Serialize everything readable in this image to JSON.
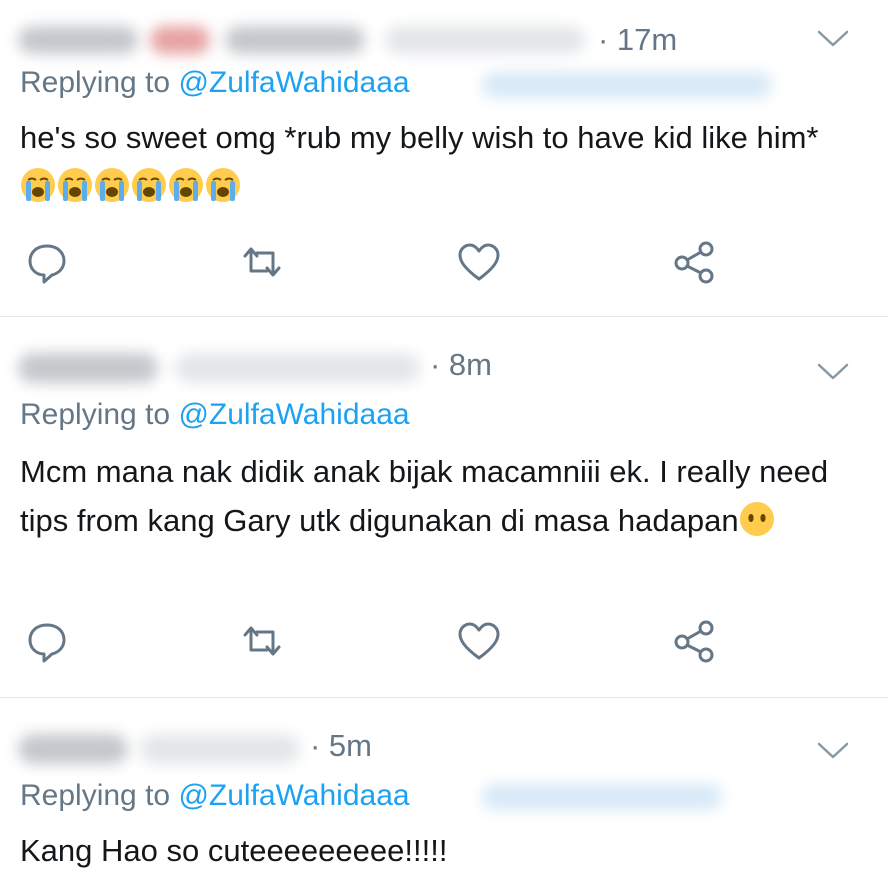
{
  "tweets": [
    {
      "time": "· 17m",
      "replying_prefix": "Replying to ",
      "handle": "@ZulfaWahidaaa",
      "text": "he's so sweet omg *rub my belly wish to have kid like him* ",
      "emojis": [
        "loudly-crying-face",
        "loudly-crying-face",
        "loudly-crying-face",
        "loudly-crying-face",
        "loudly-crying-face",
        "loudly-crying-face"
      ]
    },
    {
      "time": "· 8m",
      "replying_prefix": "Replying to ",
      "handle": "@ZulfaWahidaaa",
      "text": "Mcm mana nak didik anak bijak macamniii ek. I really need tips from kang Gary utk digunakan di masa hadapan",
      "emojis": [
        "face-without-mouth"
      ]
    },
    {
      "time": "· 5m",
      "replying_prefix": "Replying to ",
      "handle": "@ZulfaWahidaaa",
      "text": "Kang Hao so cuteeeeeeeee!!!!!",
      "emojis": []
    }
  ],
  "icons": {
    "reply": "reply-icon",
    "retweet": "retweet-icon",
    "like": "heart-icon",
    "share": "share-icon",
    "menu": "chevron-down-icon"
  },
  "colors": {
    "text": "#14171a",
    "secondary": "#657786",
    "link": "#1da1f2",
    "divider": "#e1e8ed",
    "emoji": "#ffcc4d"
  }
}
